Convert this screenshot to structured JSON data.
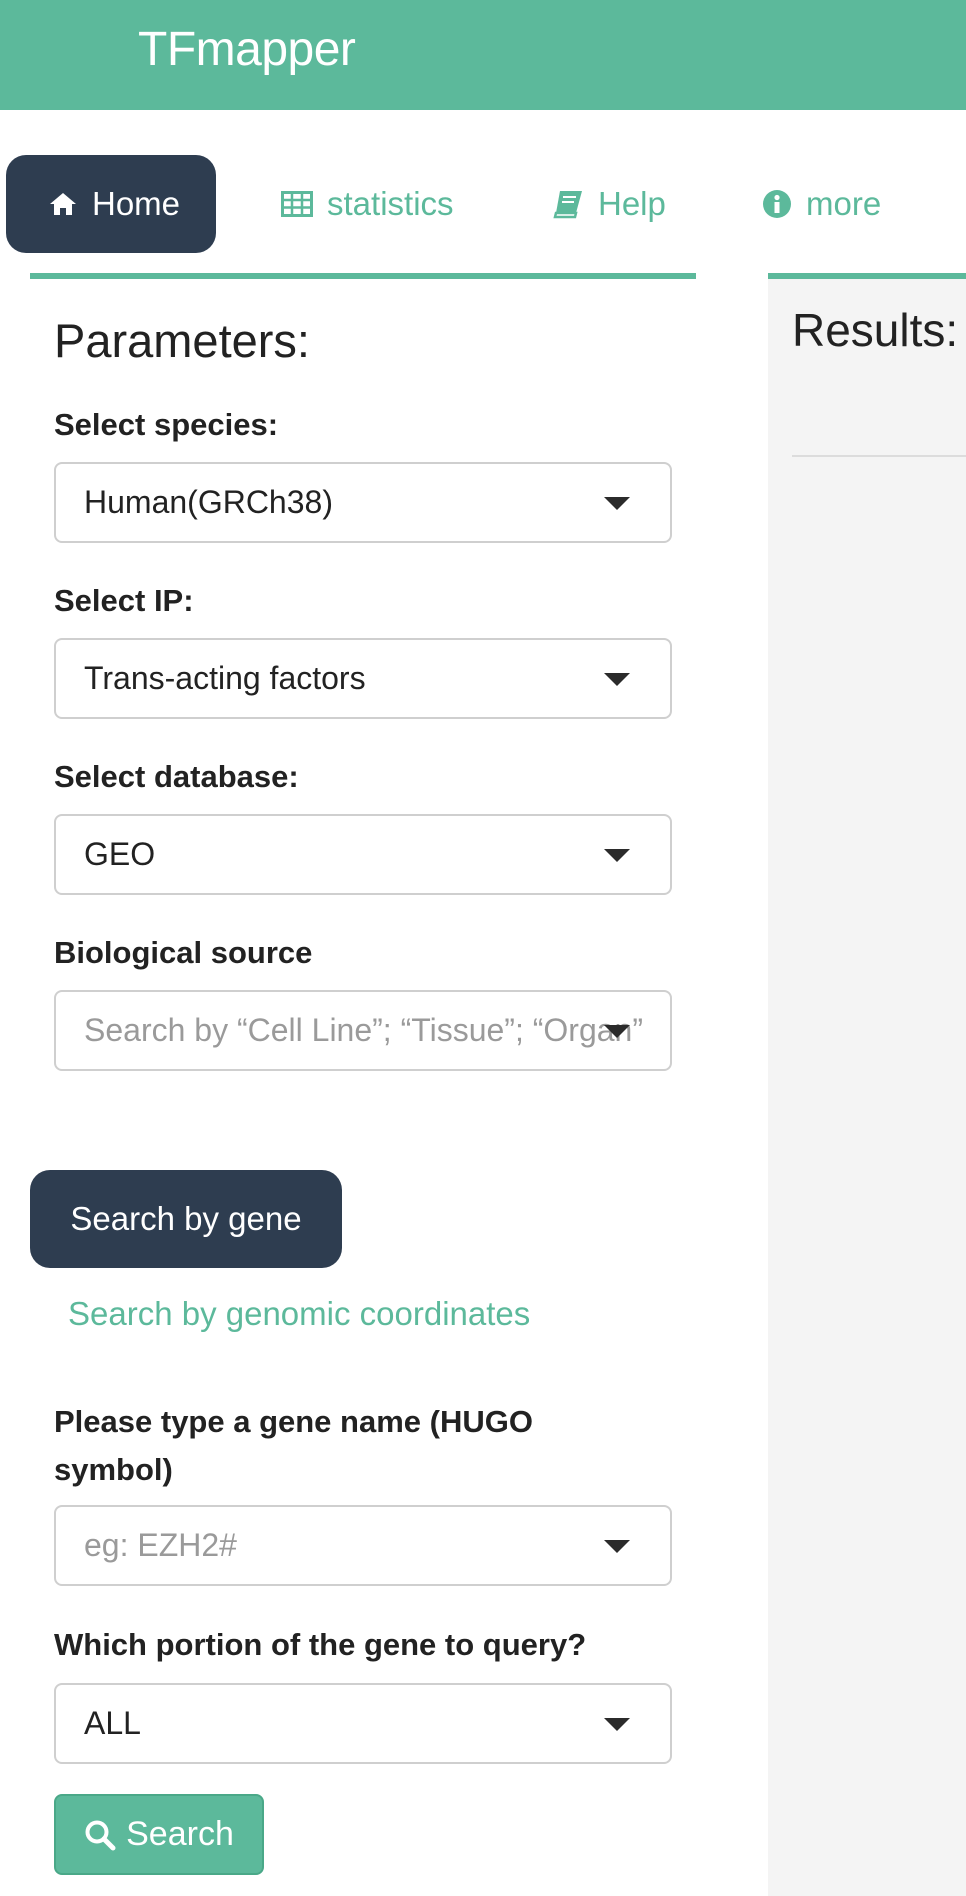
{
  "app": {
    "title": "TFmapper"
  },
  "nav": {
    "tabs": [
      {
        "label": "Home",
        "icon": "home-icon",
        "active": true
      },
      {
        "label": "statistics",
        "icon": "table-icon",
        "active": false
      },
      {
        "label": "Help",
        "icon": "book-icon",
        "active": false
      },
      {
        "label": "more",
        "icon": "info-circle-icon",
        "active": false
      }
    ]
  },
  "parameters": {
    "title": "Parameters:",
    "species": {
      "label": "Select species:",
      "value": "Human(GRCh38)"
    },
    "ip": {
      "label": "Select IP:",
      "value": "Trans-acting factors"
    },
    "database": {
      "label": "Select database:",
      "value": "GEO"
    },
    "bio_source": {
      "label": "Biological source",
      "placeholder": "Search by “Cell Line”; “Tissue”; “Organ”"
    },
    "search_tabs": {
      "gene": "Search by gene",
      "coordinates": "Search by genomic coordinates"
    },
    "gene": {
      "label_line1": "Please type a gene name (HUGO",
      "label_line2": "symbol)",
      "placeholder": "eg: EZH2#"
    },
    "portion": {
      "label": "Which portion of the gene to query?",
      "value": "ALL"
    },
    "search_button": "Search"
  },
  "results": {
    "title": "Results:"
  },
  "colors": {
    "accent": "#5cb99b",
    "dark": "#2e3d50",
    "panel_bg": "#f4f4f4"
  }
}
